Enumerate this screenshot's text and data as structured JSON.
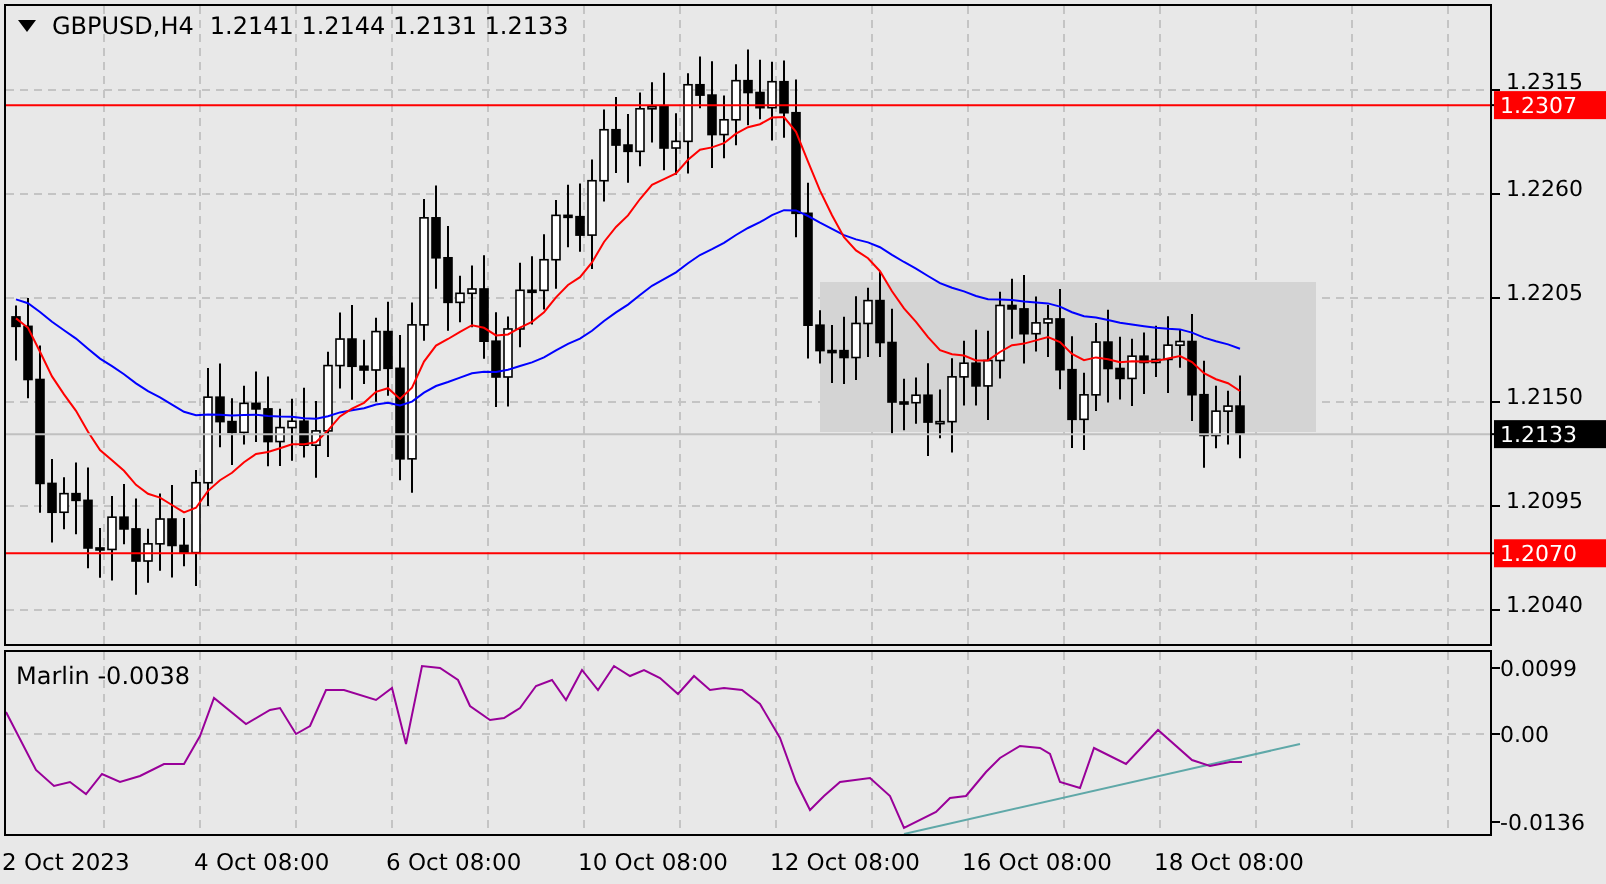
{
  "chart": {
    "symbol": "GBPUSD,H4",
    "ohlc": [
      "1.2141",
      "1.2144",
      "1.2131",
      "1.2133"
    ],
    "price_axis": [
      {
        "label": "1.2315",
        "kind": "tick"
      },
      {
        "label": "1.2307",
        "kind": "level",
        "color": "#ff0000"
      },
      {
        "label": "1.2260",
        "kind": "tick"
      },
      {
        "label": "1.2205",
        "kind": "tick"
      },
      {
        "label": "1.2150",
        "kind": "tick"
      },
      {
        "label": "1.2133",
        "kind": "bid"
      },
      {
        "label": "1.2095",
        "kind": "tick"
      },
      {
        "label": "1.2070",
        "kind": "level",
        "color": "#ff0000"
      },
      {
        "label": "1.2040",
        "kind": "tick"
      }
    ]
  },
  "indicator": {
    "name": "Marlin",
    "value": "-0.0038",
    "axis": [
      "0.0099",
      "0.00",
      "-0.0136"
    ]
  },
  "time_axis": [
    "2 Oct 2023",
    "4 Oct 08:00",
    "6 Oct 08:00",
    "10 Oct 08:00",
    "12 Oct 08:00",
    "16 Oct 08:00",
    "18 Oct 08:00"
  ]
}
